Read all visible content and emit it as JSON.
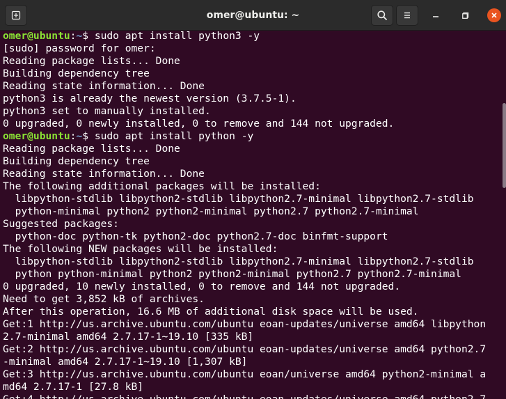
{
  "window": {
    "title": "omer@ubuntu: ~"
  },
  "icons": {
    "new_tab": "new-tab-icon",
    "search": "search-icon",
    "menu": "hamburger-menu-icon",
    "minimize": "minimize-icon",
    "maximize": "maximize-icon",
    "close": "close-icon"
  },
  "colors": {
    "background": "#300a24",
    "prompt_user": "#8ae234",
    "prompt_path": "#729fcf",
    "text": "#ffffff",
    "close_button": "#e95420"
  },
  "terminal": {
    "lines": [
      {
        "type": "prompt",
        "user": "omer@ubuntu",
        "sep": ":",
        "path": "~",
        "cmd": "$ sudo apt install python3 -y"
      },
      {
        "type": "output",
        "text": "[sudo] password for omer:"
      },
      {
        "type": "output",
        "text": "Reading package lists... Done"
      },
      {
        "type": "output",
        "text": "Building dependency tree"
      },
      {
        "type": "output",
        "text": "Reading state information... Done"
      },
      {
        "type": "output",
        "text": "python3 is already the newest version (3.7.5-1)."
      },
      {
        "type": "output",
        "text": "python3 set to manually installed."
      },
      {
        "type": "output",
        "text": "0 upgraded, 0 newly installed, 0 to remove and 144 not upgraded."
      },
      {
        "type": "prompt",
        "user": "omer@ubuntu",
        "sep": ":",
        "path": "~",
        "cmd": "$ sudo apt install python -y"
      },
      {
        "type": "output",
        "text": "Reading package lists... Done"
      },
      {
        "type": "output",
        "text": "Building dependency tree"
      },
      {
        "type": "output",
        "text": "Reading state information... Done"
      },
      {
        "type": "output",
        "text": "The following additional packages will be installed:"
      },
      {
        "type": "output",
        "text": "  libpython-stdlib libpython2-stdlib libpython2.7-minimal libpython2.7-stdlib"
      },
      {
        "type": "output",
        "text": "  python-minimal python2 python2-minimal python2.7 python2.7-minimal"
      },
      {
        "type": "output",
        "text": "Suggested packages:"
      },
      {
        "type": "output",
        "text": "  python-doc python-tk python2-doc python2.7-doc binfmt-support"
      },
      {
        "type": "output",
        "text": "The following NEW packages will be installed:"
      },
      {
        "type": "output",
        "text": "  libpython-stdlib libpython2-stdlib libpython2.7-minimal libpython2.7-stdlib"
      },
      {
        "type": "output",
        "text": "  python python-minimal python2 python2-minimal python2.7 python2.7-minimal"
      },
      {
        "type": "output",
        "text": "0 upgraded, 10 newly installed, 0 to remove and 144 not upgraded."
      },
      {
        "type": "output",
        "text": "Need to get 3,852 kB of archives."
      },
      {
        "type": "output",
        "text": "After this operation, 16.6 MB of additional disk space will be used."
      },
      {
        "type": "output",
        "text": "Get:1 http://us.archive.ubuntu.com/ubuntu eoan-updates/universe amd64 libpython"
      },
      {
        "type": "output",
        "text": "2.7-minimal amd64 2.7.17-1~19.10 [335 kB]"
      },
      {
        "type": "output",
        "text": "Get:2 http://us.archive.ubuntu.com/ubuntu eoan-updates/universe amd64 python2.7"
      },
      {
        "type": "output",
        "text": "-minimal amd64 2.7.17-1~19.10 [1,307 kB]"
      },
      {
        "type": "output",
        "text": "Get:3 http://us.archive.ubuntu.com/ubuntu eoan/universe amd64 python2-minimal a"
      },
      {
        "type": "output",
        "text": "md64 2.7.17-1 [27.8 kB]"
      },
      {
        "type": "output",
        "text": "Get:4 http://us.archive.ubuntu.com/ubuntu eoan-updates/universe amd64 python2.7"
      }
    ]
  }
}
